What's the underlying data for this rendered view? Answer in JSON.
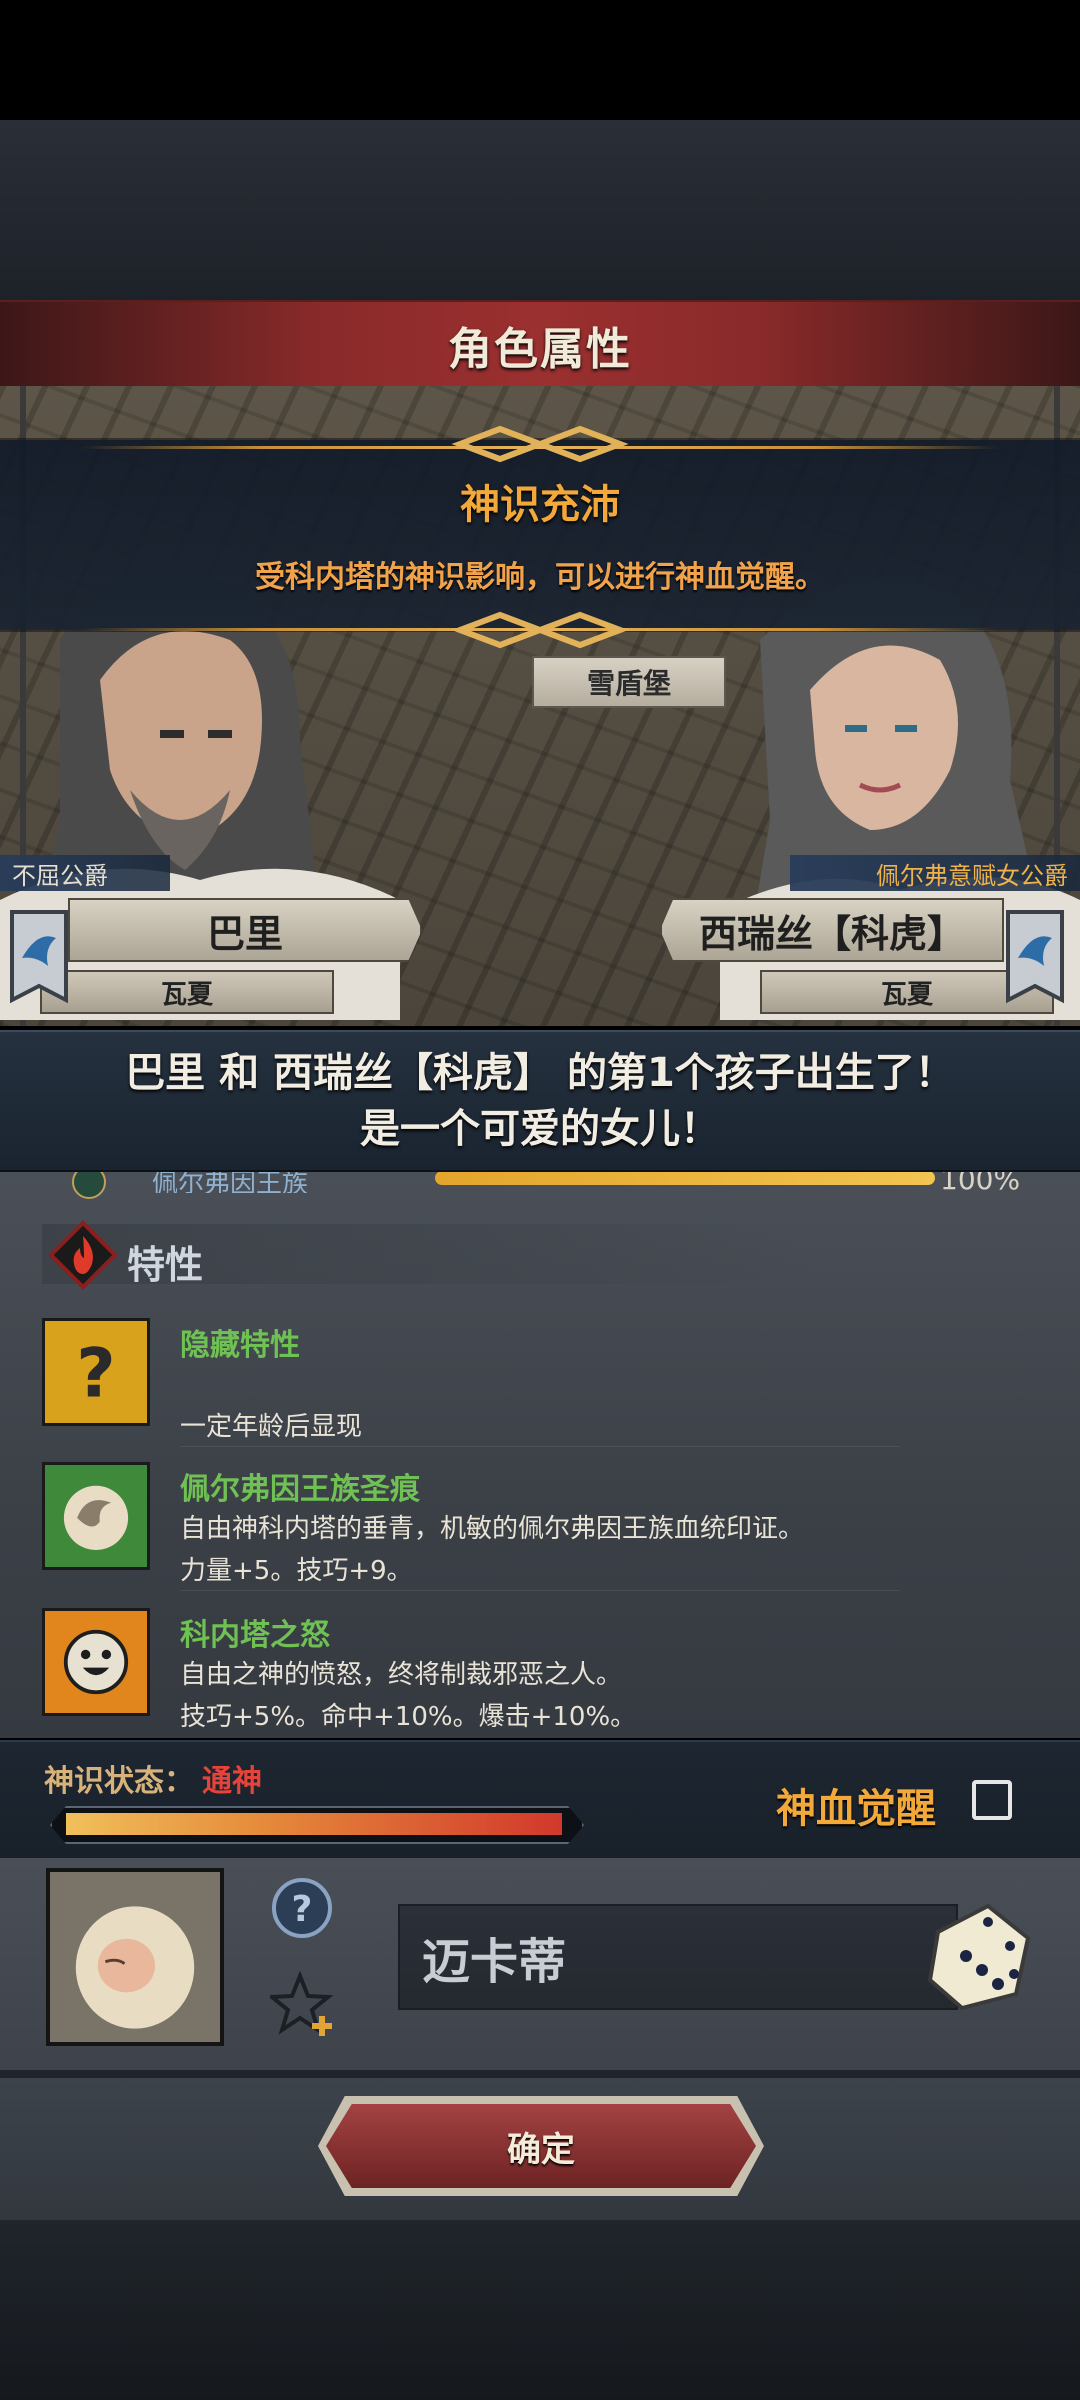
{
  "header": {
    "title": "角色属性"
  },
  "notification": {
    "title": "神识充沛",
    "description": "受科内塔的神识影响，可以进行神血觉醒。"
  },
  "location": "雪盾堡",
  "father": {
    "rank": "不屈公爵",
    "name": "巴里",
    "house": "瓦夏"
  },
  "mother": {
    "rank": "佩尔弗意赋女公爵",
    "name": "西瑞丝【科虎】",
    "house": "瓦夏"
  },
  "announcement": {
    "line1": "巴里 和 西瑞丝【科虎】 的第1个孩子出生了！",
    "line2": "是一个可爱的女儿！"
  },
  "clan": {
    "name": "佩尔弗因王族",
    "percent_label": "100%",
    "fill": 1.0
  },
  "traits_section": {
    "title": "特性"
  },
  "traits": [
    {
      "name": "隐藏特性",
      "line1": "",
      "line2": "一定年龄后显现",
      "icon": "question-mark-icon"
    },
    {
      "name": "佩尔弗因王族圣痕",
      "line1": "自由神科内塔的垂青，机敏的佩尔弗因王族血统印证。",
      "line2": "力量+5。技巧+9。",
      "icon": "swirl-mark-icon"
    },
    {
      "name": "科内塔之怒",
      "line1": "自由之神的愤怒，终将制裁邪恶之人。",
      "line2": "技巧+5%。命中+10%。爆击+10%。",
      "icon": "smiley-sun-icon"
    }
  ],
  "divine_status": {
    "label": "神识状态：",
    "value": "通神",
    "fill": 1.0,
    "awaken_label": "神血觉醒",
    "awaken_checked": false
  },
  "child": {
    "name_value": "迈卡蒂"
  },
  "footer": {
    "confirm_label": "确定"
  },
  "colors": {
    "accent_orange": "#f3a93a",
    "trait_green": "#6fc153",
    "status_red": "#e6443a",
    "banner_red": "#9b3030"
  }
}
